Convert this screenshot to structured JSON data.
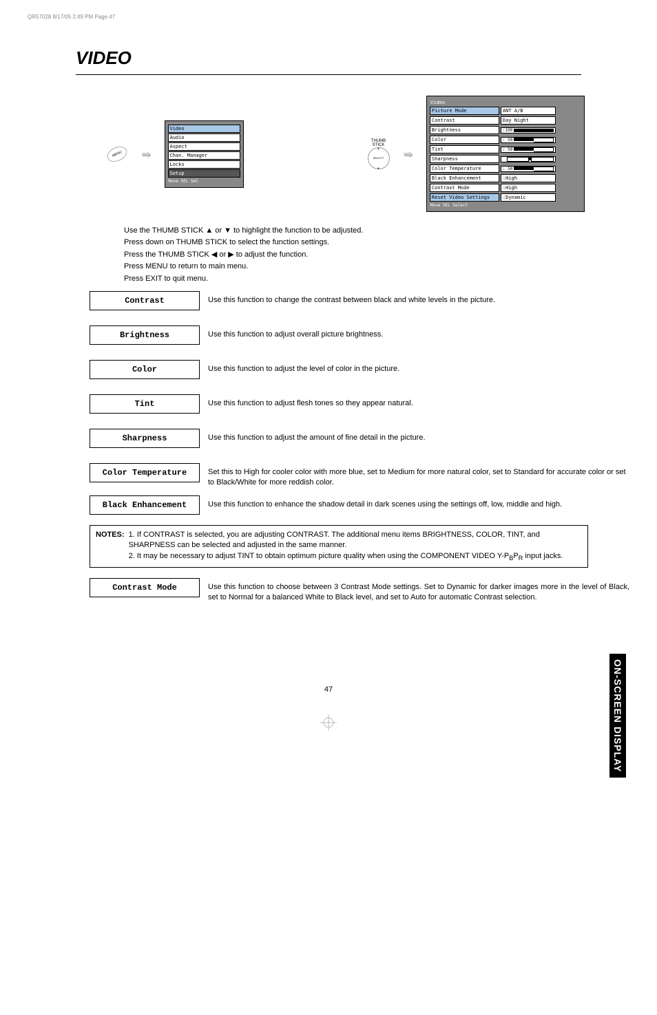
{
  "header_line": "QR57028  8/17/05  2:49 PM  Page 47",
  "title": "VIDEO",
  "left_menu": {
    "items": [
      "Video",
      "Audio",
      "Aspect",
      "Chan. Manager",
      "Locks",
      "Setup"
    ],
    "footer": "Move  SEL Sel"
  },
  "menu_button": "MENU",
  "thumb": {
    "label1": "THUMB",
    "label2": "STICK",
    "center": "SELECT"
  },
  "video_menu": {
    "title": "Video",
    "rows": [
      {
        "label": "Picture Mode",
        "right": "ANT A/B"
      },
      {
        "label": "Contrast",
        "val": ":100",
        "alt": "Day      Night"
      },
      {
        "label": "Brightness",
        "val": ": 50"
      },
      {
        "label": "Color",
        "val": ": 50"
      },
      {
        "label": "Tint",
        "val": ""
      },
      {
        "label": "Sharpness",
        "val": ": 50"
      },
      {
        "label": "Color Temperature",
        "val": ":High"
      },
      {
        "label": "Black Enhancement",
        "val": ":High"
      },
      {
        "label": "Contrast Mode",
        "val": ":Dynamic"
      },
      {
        "label": "Reset Video Settings"
      }
    ],
    "footer": "Move SEL Select"
  },
  "intro": {
    "l1": "Use the THUMB STICK ▲ or ▼ to highlight the function to be adjusted.",
    "l2": "Press down on THUMB STICK to select the function settings.",
    "l3": "Press the THUMB STICK ◀ or ▶ to adjust the function.",
    "l4": "Press MENU to return to main menu.",
    "l5": "Press EXIT to quit menu."
  },
  "functions": {
    "contrast": {
      "label": "Contrast",
      "desc": "Use this function to change the contrast between black and white levels in the picture."
    },
    "brightness": {
      "label": "Brightness",
      "desc": "Use this function to adjust overall picture brightness."
    },
    "color": {
      "label": "Color",
      "desc": "Use this function to adjust the level of color in the picture."
    },
    "tint": {
      "label": "Tint",
      "desc": "Use this function to adjust flesh tones so they appear natural."
    },
    "sharpness": {
      "label": "Sharpness",
      "desc": "Use this function to adjust the amount of fine detail in the picture."
    },
    "color_temp": {
      "label": "Color Temperature",
      "desc": "Set this to High for cooler color with more blue, set to Medium for more natural color, set to Standard for accurate color or set to Black/White for more reddish color."
    },
    "black_enh": {
      "label": "Black Enhancement",
      "desc": "Use this function to enhance the shadow detail in dark scenes using the settings off, low, middle and high."
    },
    "contrast_mode": {
      "label": "Contrast Mode",
      "desc": "Use this function to choose between 3 Contrast Mode settings.  Set to Dynamic for darker images more in the level of Black, set to Normal for a balanced White to Black level, and set to Auto for automatic Contrast selection."
    }
  },
  "notes": {
    "label": "NOTES:",
    "n1": "1.  If CONTRAST is selected, you are adjusting CONTRAST.  The additional menu items BRIGHTNESS, COLOR, TINT, and SHARPNESS can be selected and adjusted in the same manner.",
    "n2a": "2.  It may be necessary to adjust TINT to obtain optimum picture quality when using the COMPONENT VIDEO Y-P",
    "n2b": "P",
    "n2c": " input jacks.",
    "sub_b": "B",
    "sub_r": "R"
  },
  "side_tab": "ON-SCREEN DISPLAY",
  "page_number": "47"
}
